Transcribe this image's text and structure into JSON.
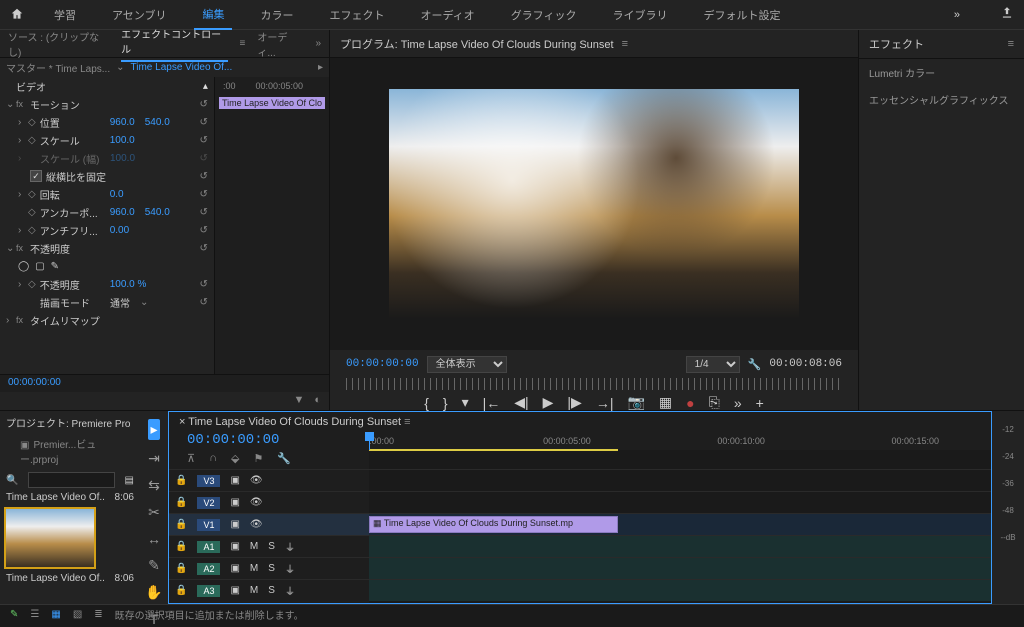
{
  "topbar": {
    "tabs": [
      "学習",
      "アセンブリ",
      "編集",
      "カラー",
      "エフェクト",
      "オーディオ",
      "グラフィック",
      "ライブラリ",
      "デフォルト設定"
    ],
    "active": 2
  },
  "left_tabs": {
    "source_label": "ソース : (クリップなし)",
    "ec_label": "エフェクトコントロール",
    "audio_label": "オーディ..."
  },
  "ec": {
    "master_label": "マスター * Time Laps...",
    "clip_label": "Time Lapse Video Of...",
    "tl_start": ":00",
    "tl_span": "00:00:05:00",
    "clip_chip": "Time Lapse Video Of Clo",
    "video_header": "ビデオ",
    "motion": "モーション",
    "position": "位置",
    "pos_x": "960.0",
    "pos_y": "540.0",
    "scale": "スケール",
    "scale_v": "100.0",
    "scale_w": "スケール (幅)",
    "scale_w_v": "100.0",
    "uniform": "縦横比を固定",
    "rotation": "回転",
    "rot_v": "0.0",
    "anchor": "アンカーポ...",
    "anc_x": "960.0",
    "anc_y": "540.0",
    "antiflicker": "アンチフリ...",
    "antif_v": "0.00",
    "opacity": "不透明度",
    "opacity_prop": "不透明度",
    "opacity_v": "100.0 %",
    "blend": "描画モード",
    "blend_v": "通常",
    "timeremap": "タイムリマップ",
    "tc": "00:00:00:00"
  },
  "program": {
    "title": "プログラム: Time Lapse Video Of Clouds During Sunset",
    "tc_left": "00:00:00:00",
    "fit": "全体表示",
    "zoom": "1/4",
    "tc_right": "00:00:08:06"
  },
  "effects": {
    "title": "エフェクト",
    "items": [
      "Lumetri カラー",
      "エッセンシャルグラフィックス"
    ]
  },
  "project": {
    "title": "プロジェクト: Premiere Pro",
    "file": "Premier...ビュー.prproj",
    "item_name": "Time Lapse Video Of..",
    "item_dur": "8:06",
    "item_name2": "Time Lapse Video Of..",
    "item_dur2": "8:06"
  },
  "timeline": {
    "seq_name": "Time Lapse Video Of Clouds During Sunset",
    "tc": "00:00:00:00",
    "marks": [
      ":00:00",
      "00:00:05:00",
      "00:00:10:00",
      "00:00:15:00"
    ],
    "tracks_v": [
      "V3",
      "V2",
      "V1"
    ],
    "tracks_a": [
      "A1",
      "A2",
      "A3"
    ],
    "clip": "Time Lapse Video Of Clouds During Sunset.mp",
    "meter_labels": [
      "-12",
      "-24",
      "-36",
      "-48",
      "--dB"
    ]
  },
  "status": {
    "msg": "既存の選択項目に追加または削除します。"
  }
}
